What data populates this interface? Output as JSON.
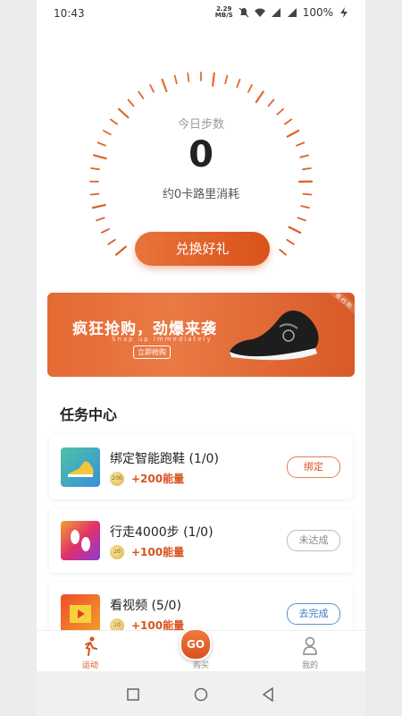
{
  "status_bar": {
    "time": "10:43",
    "speed_top": "2.29",
    "speed_unit": "MB/S",
    "battery": "100%"
  },
  "dial": {
    "label": "今日步数",
    "value": "0",
    "subtitle": "约0卡路里消耗"
  },
  "exchange_button": "兑换好礼",
  "banner": {
    "title": "疯狂抢购，劲爆来袭",
    "subtitle": "Snap up immediately",
    "button": "立即抢购",
    "tag": "易·约·购"
  },
  "tasks_title": "任务中心",
  "tasks": [
    {
      "name": "绑定智能跑鞋 (1/0)",
      "coin": "200",
      "reward": "+200能量",
      "button": "绑定",
      "icon": "shoe-icon"
    },
    {
      "name": "行走4000步 (1/0)",
      "coin": "20",
      "reward": "+100能量",
      "button": "未达成",
      "icon": "footprints-icon"
    },
    {
      "name": "看视频 (5/0)",
      "coin": "10",
      "reward": "+100能量",
      "button": "去完成",
      "icon": "video-icon"
    }
  ],
  "tabbar": {
    "sport": "运动",
    "buy": "购买",
    "go": "GO",
    "mine": "我的"
  },
  "colors": {
    "accent": "#d9531e",
    "blue": "#3d78c8"
  }
}
